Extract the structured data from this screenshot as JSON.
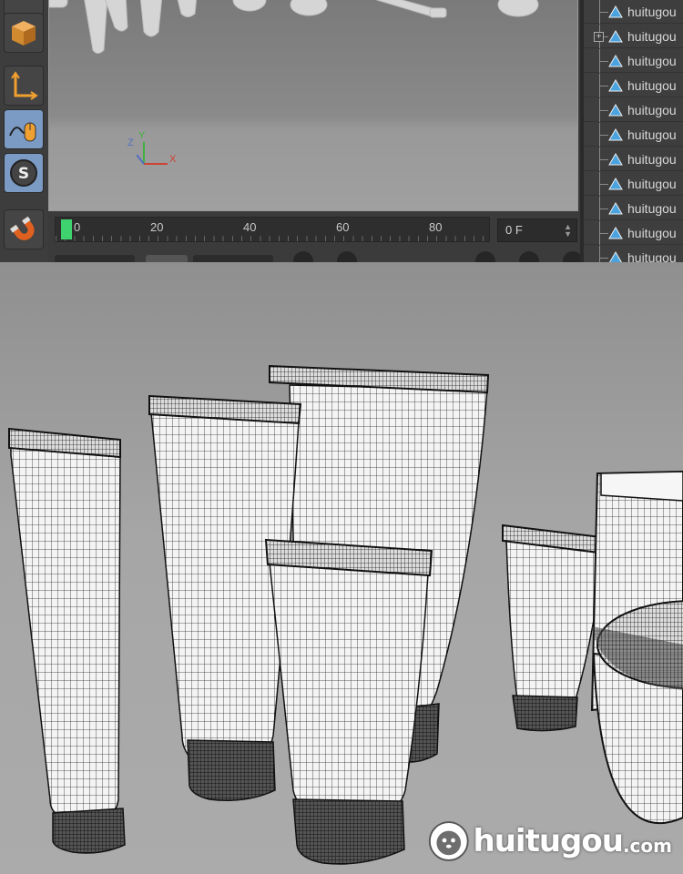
{
  "timeline": {
    "ticks": [
      "0",
      "20",
      "40",
      "60",
      "80"
    ],
    "current_frame": "0 F"
  },
  "viewport": {
    "axis_labels": {
      "x": "X",
      "y": "Y",
      "z": "Z"
    }
  },
  "object_manager": {
    "items": [
      {
        "label": "huitugou"
      },
      {
        "label": "huitugou"
      },
      {
        "label": "huitugou"
      },
      {
        "label": "huitugou"
      },
      {
        "label": "huitugou"
      },
      {
        "label": "huitugou"
      },
      {
        "label": "huitugou"
      },
      {
        "label": "huitugou"
      },
      {
        "label": "huitugou"
      },
      {
        "label": "huitugou"
      },
      {
        "label": "huitugou"
      }
    ]
  },
  "toolbar": {
    "icons": [
      "cube-icon",
      "axis-icon",
      "mouse-icon",
      "snap-icon",
      "magnet-icon"
    ]
  },
  "watermark": {
    "brand": "huitugou",
    "suffix": ".com"
  },
  "colors": {
    "active_tool": "#7b9ac4",
    "timeline_marker": "#3ed36e",
    "axis_x": "#d04030",
    "axis_y": "#40b040",
    "axis_z": "#5070c0",
    "object_icon": "#4aa3df"
  }
}
